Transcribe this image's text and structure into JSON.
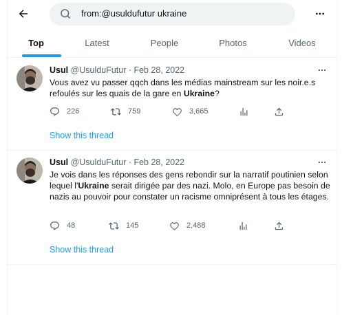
{
  "search": {
    "query": "from:@usuldufutur ukraine"
  },
  "tabs": [
    {
      "label": "Top"
    },
    {
      "label": "Latest"
    },
    {
      "label": "People"
    },
    {
      "label": "Photos"
    },
    {
      "label": "Videos"
    }
  ],
  "tweets": [
    {
      "name": "Usul",
      "handle": "@UsulduFutur",
      "sep": " · ",
      "date": "Feb 28, 2022",
      "text_before": "Vous avez vu passer qqch dans les médias mainstream sur les noir.e.s refoulés sur les quais de la gare en ",
      "text_bold": "Ukraine",
      "text_after": "?",
      "replies": "226",
      "retweets": "759",
      "likes": "3,665",
      "thread_label": "Show this thread"
    },
    {
      "name": "Usul",
      "handle": "@UsulduFutur",
      "sep": " · ",
      "date": "Feb 28, 2022",
      "text_before": "Je vois dans les réponses des gens rebondir sur la narratif poutinien selon lequel l'",
      "text_bold": "Ukraine",
      "text_after": " serait dirigée par des nazi. Molo, en Europe pas besoin de nazis au pouvoir pour constater un racisme omniprésent à tous les étages.",
      "replies": "48",
      "retweets": "145",
      "likes": "2,488",
      "thread_label": "Show this thread"
    }
  ],
  "colors": {
    "accent": "#1d9bf0",
    "muted": "#536471",
    "text": "#0f1419",
    "border": "#eff3f4",
    "search_bg": "#eff3f4"
  },
  "icons": [
    "back-arrow-icon",
    "search-icon",
    "more-icon",
    "reply-icon",
    "retweet-icon",
    "like-icon",
    "analytics-icon",
    "share-icon"
  ]
}
